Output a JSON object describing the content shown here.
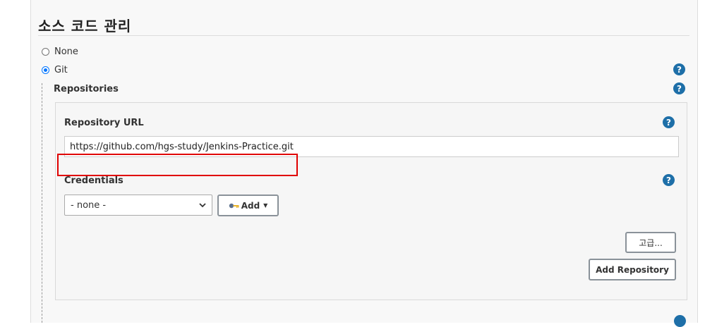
{
  "section": {
    "title": "소스 코드 관리"
  },
  "scm_options": [
    {
      "label": "None",
      "selected": false
    },
    {
      "label": "Git",
      "selected": true
    }
  ],
  "repositories": {
    "label": "Repositories",
    "repository_url": {
      "label": "Repository URL",
      "value": "https://github.com/hgs-study/Jenkins-Practice.git"
    },
    "credentials": {
      "label": "Credentials",
      "selected": "- none -",
      "add_button": "Add"
    },
    "advanced_button": "고급...",
    "add_repository_button": "Add Repository"
  },
  "help": {
    "glyph": "?"
  },
  "colors": {
    "help_icon": "#1e6fa8",
    "radio_checked": "#0075ff",
    "highlight_box": "#e00000"
  }
}
